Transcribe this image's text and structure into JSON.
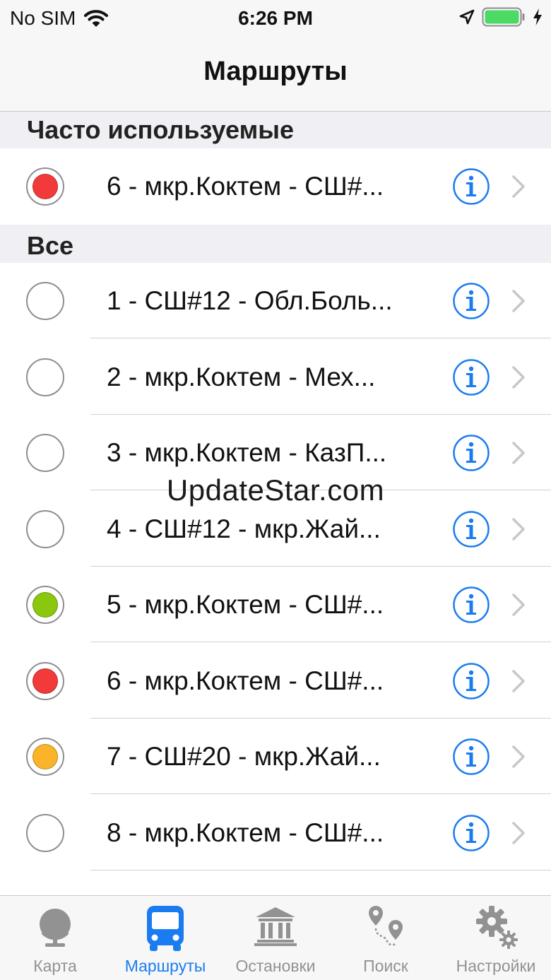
{
  "status": {
    "carrier": "No SIM",
    "time": "6:26 PM"
  },
  "nav": {
    "title": "Маршруты"
  },
  "sections": {
    "frequent": "Часто используемые",
    "all": "Все"
  },
  "frequent_items": [
    {
      "label": "6 - мкр.Коктем - СШ#...",
      "color": "#f23a3a"
    }
  ],
  "all_items": [
    {
      "label": "1 - СШ#12 - Обл.Боль...",
      "color": ""
    },
    {
      "label": "2 - мкр.Коктем - Мех...",
      "color": ""
    },
    {
      "label": "3 - мкр.Коктем - КазП...",
      "color": ""
    },
    {
      "label": "4 - СШ#12 - мкр.Жай...",
      "color": ""
    },
    {
      "label": "5 - мкр.Коктем - СШ#...",
      "color": "#8cc70f"
    },
    {
      "label": "6 - мкр.Коктем - СШ#...",
      "color": "#f23a3a"
    },
    {
      "label": "7 - СШ#20 - мкр.Жай...",
      "color": "#fbb429"
    },
    {
      "label": "8 - мкр.Коктем - СШ#...",
      "color": ""
    }
  ],
  "watermark": "UpdateStar.com",
  "tabs": [
    {
      "label": "Карта",
      "icon": "globe-icon"
    },
    {
      "label": "Маршруты",
      "icon": "bus-icon"
    },
    {
      "label": "Остановки",
      "icon": "building-icon"
    },
    {
      "label": "Поиск",
      "icon": "route-pins-icon"
    },
    {
      "label": "Настройки",
      "icon": "gears-icon"
    }
  ],
  "colors": {
    "accent": "#1a7cf0",
    "inactive": "#929292",
    "battery": "#4cd964"
  }
}
